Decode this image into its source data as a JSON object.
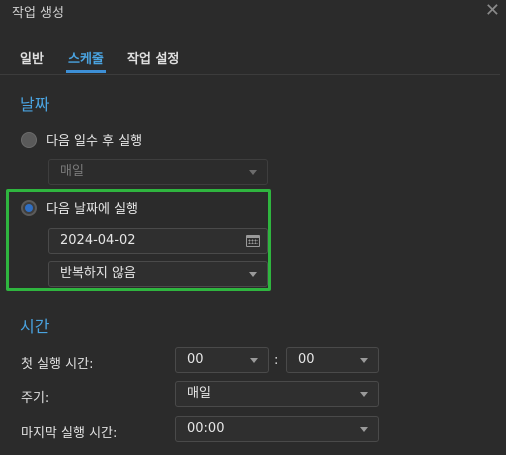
{
  "dialog": {
    "title": "작업 생성",
    "close_glyph": "✕"
  },
  "tabs": [
    {
      "label": "일반",
      "active": false
    },
    {
      "label": "스케줄",
      "active": true
    },
    {
      "label": "작업 설정",
      "active": false
    }
  ],
  "date_section": {
    "title": "날짜",
    "option_days": {
      "label": "다음 일수 후 실행",
      "checked": false,
      "select_value": "매일"
    },
    "option_date": {
      "label": "다음 날짜에 실행",
      "checked": true,
      "date_value": "2024-04-02",
      "repeat_value": "반복하지 않음"
    }
  },
  "time_section": {
    "title": "시간",
    "first_run": {
      "label": "첫 실행 시간:",
      "hour": "00",
      "minute": "00",
      "separator": ":"
    },
    "frequency": {
      "label": "주기:",
      "value": "매일"
    },
    "last_run": {
      "label": "마지막 실행 시간:",
      "value": "00:00"
    }
  },
  "colors": {
    "accent": "#4aa3e0",
    "highlight": "#2fb53f",
    "background": "#2b2b2b"
  },
  "icons": {
    "close": "close-icon",
    "calendar": "calendar-icon",
    "dropdown": "chevron-down-icon"
  }
}
